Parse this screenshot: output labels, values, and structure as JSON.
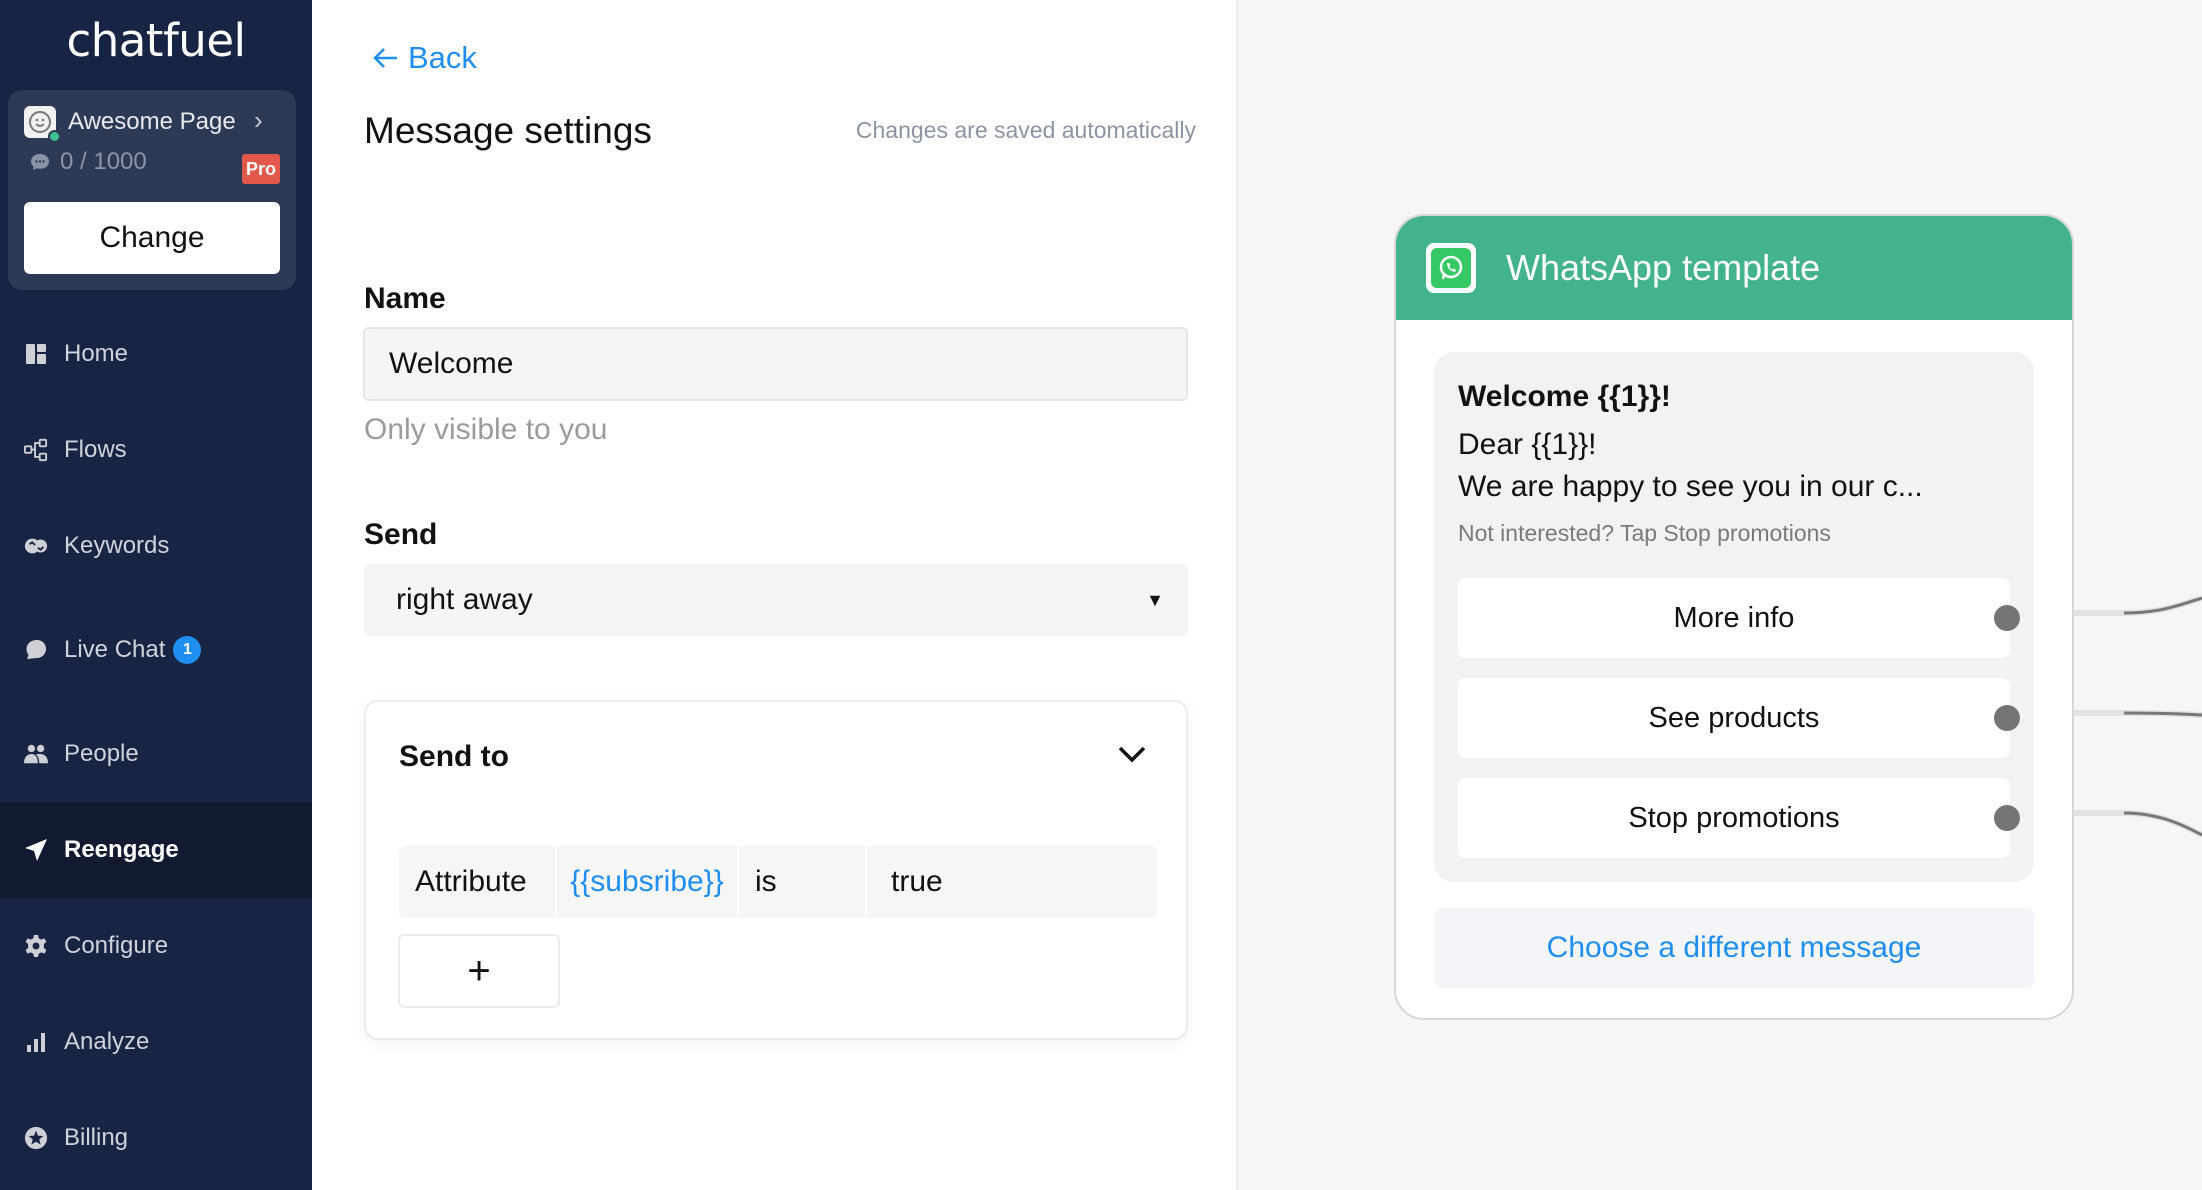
{
  "sidebar": {
    "logo": "chatfuel",
    "page": {
      "name": "Awesome Page",
      "message_count": "0 / 1000",
      "plan_badge": "Pro",
      "change_label": "Change"
    },
    "items": [
      {
        "label": "Home",
        "icon": "home-icon"
      },
      {
        "label": "Flows",
        "icon": "flows-icon"
      },
      {
        "label": "Keywords",
        "icon": "keywords-icon"
      },
      {
        "label": "Live Chat",
        "icon": "chat-bubble-icon",
        "badge": "1"
      },
      {
        "label": "People",
        "icon": "people-icon"
      },
      {
        "label": "Reengage",
        "icon": "paper-plane-icon",
        "active": true
      },
      {
        "label": "Configure",
        "icon": "gear-icon"
      },
      {
        "label": "Analyze",
        "icon": "bar-chart-icon"
      },
      {
        "label": "Billing",
        "icon": "star-badge-icon"
      }
    ]
  },
  "settings": {
    "back_label": "Back",
    "title": "Message settings",
    "autosave_note": "Changes are saved automatically",
    "name_label": "Name",
    "name_value": "Welcome",
    "name_hint": "Only visible to you",
    "send_label": "Send",
    "send_value": "right away",
    "send_to": {
      "title": "Send to",
      "condition": {
        "type": "Attribute",
        "attribute": "{{subsribe}}",
        "operator": "is",
        "value": "true"
      },
      "add_label": "+"
    }
  },
  "template_card": {
    "title": "WhatsApp template",
    "header_text": "Welcome {{1}}!",
    "body_line1": "Dear {{1}}!",
    "body_line2": "We are happy to see you in our c...",
    "footer": "Not interested? Tap Stop promotions",
    "buttons": [
      "More info",
      "See products",
      "Stop promotions"
    ],
    "choose_label": "Choose a different message"
  },
  "colors": {
    "sidebar_bg": "#172444",
    "accent_blue": "#1f8ef1",
    "whatsapp_header": "#42b38a",
    "pro_badge": "#e2584a"
  }
}
